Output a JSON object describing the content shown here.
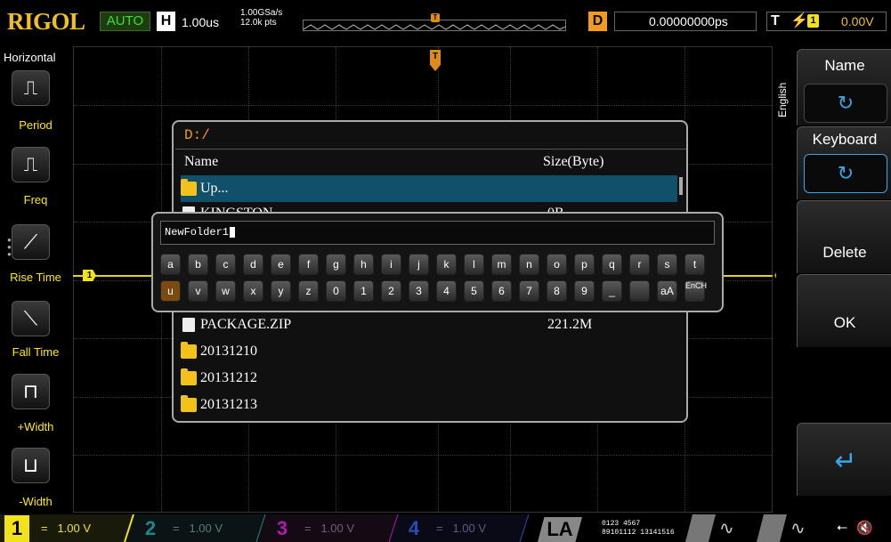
{
  "header": {
    "brand": "RIGOL",
    "run_mode": "AUTO",
    "horizontal": {
      "badge": "H",
      "timebase": "1.00us"
    },
    "sample_rate": "1.00GSa/s",
    "memory_depth": "12.0k pts",
    "trigger_pos_label": "T",
    "delay": {
      "badge": "D",
      "value": "0.00000000ps"
    },
    "trigger": {
      "badge": "T",
      "source": "1",
      "level": "0.00V"
    },
    "colors": {
      "brand": "#f0c020",
      "auto": "#3fe02a",
      "delay": "#f29a1a",
      "trigger_level": "#f2c21a"
    }
  },
  "left_panel": {
    "title": "Horizontal",
    "items": [
      {
        "label": "Period",
        "icon": "period-icon"
      },
      {
        "label": "Freq",
        "icon": "frequency-icon"
      },
      {
        "label": "Rise Time",
        "icon": "rise-time-icon"
      },
      {
        "label": "Fall Time",
        "icon": "fall-time-icon"
      },
      {
        "label": "+Width",
        "icon": "positive-width-icon"
      },
      {
        "label": "-Width",
        "icon": "negative-width-icon"
      }
    ]
  },
  "right_menu": {
    "language_tab": "English",
    "items": [
      {
        "label": "Name",
        "has_knob": true
      },
      {
        "label": "Keyboard",
        "has_knob": true,
        "active": true
      },
      {
        "label": "Delete"
      },
      {
        "label": "OK"
      },
      {
        "label": "",
        "icon": "enter-icon"
      }
    ]
  },
  "file_dialog": {
    "path": "D:/",
    "columns": {
      "name": "Name",
      "size": "Size(Byte)"
    },
    "rows": [
      {
        "name": "Up...",
        "size": "",
        "type": "up",
        "selected": true
      },
      {
        "name": "KINGSTON",
        "size": "0B",
        "type": "file"
      },
      {
        "name": "PACKAGE.ZIP",
        "size": "221.2M",
        "type": "file"
      },
      {
        "name": "20131210",
        "size": "",
        "type": "folder"
      },
      {
        "name": "20131212",
        "size": "",
        "type": "folder"
      },
      {
        "name": "20131213",
        "size": "",
        "type": "folder"
      }
    ]
  },
  "keyboard": {
    "input_value": "NewFolder1",
    "row1": [
      "a",
      "b",
      "c",
      "d",
      "e",
      "f",
      "g",
      "h",
      "i",
      "j",
      "k",
      "l",
      "m",
      "n",
      "o",
      "p",
      "q",
      "r",
      "s",
      "t"
    ],
    "row2": [
      "u",
      "v",
      "w",
      "x",
      "y",
      "z",
      "0",
      "1",
      "2",
      "3",
      "4",
      "5",
      "6",
      "7",
      "8",
      "9",
      "_",
      "",
      "aA",
      "EnCH"
    ],
    "active_key": "u"
  },
  "markers": {
    "ch1": "1",
    "trig_level": "T",
    "trig_pos": "T"
  },
  "bottom_bar": {
    "channels": [
      {
        "num": "1",
        "coupling": "=",
        "scale": "1.00 V",
        "color": "#f2e21a",
        "active": true
      },
      {
        "num": "2",
        "coupling": "=",
        "scale": "1.00 V",
        "color": "#1a8a8a"
      },
      {
        "num": "3",
        "coupling": "=",
        "scale": "1.00 V",
        "color": "#b01ab0"
      },
      {
        "num": "4",
        "coupling": "=",
        "scale": "1.00 V",
        "color": "#2a4ab8"
      }
    ],
    "la_label": "LA",
    "la_groups": "0123 4567",
    "la_groups2": "89101112 13141516",
    "status_icons": [
      "usb-icon",
      "speaker-icon"
    ]
  }
}
